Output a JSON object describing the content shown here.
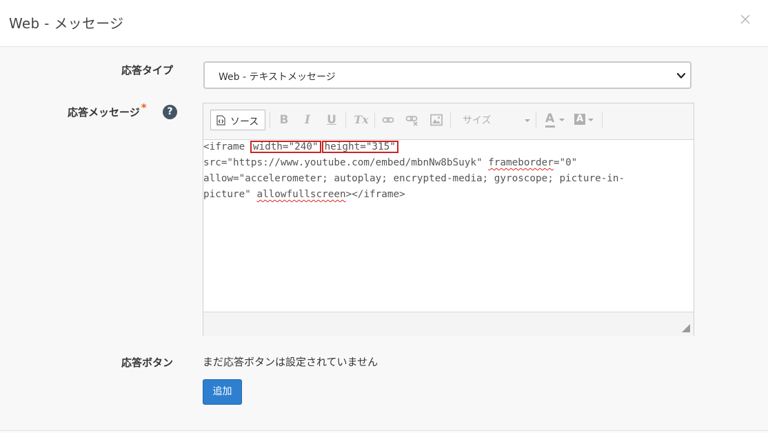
{
  "modal": {
    "title": "Web - メッセージ",
    "close_icon": "close-icon"
  },
  "form": {
    "response_type": {
      "label": "応答タイプ",
      "selected": "Web - テキストメッセージ"
    },
    "response_message": {
      "label": "応答メッセージ",
      "required_mark": "*",
      "help_glyph": "?"
    },
    "response_button": {
      "label": "応答ボタン",
      "empty_text": "まだ応答ボタンは設定されていません",
      "add_label": "追加"
    }
  },
  "toolbar": {
    "source_label": "ソース",
    "bold": "B",
    "italic": "I",
    "underline": "U",
    "remove_format": "Tx",
    "size_label": "サイズ",
    "text_color": "A",
    "bg_color": "A",
    "icons": [
      "source-icon",
      "bold-icon",
      "italic-icon",
      "underline-icon",
      "remove-format-icon",
      "link-icon",
      "unlink-icon",
      "image-icon",
      "text-color-icon",
      "background-color-icon"
    ]
  },
  "editor": {
    "line1_prefix": "<iframe ",
    "line1_width": "width=\"240\"",
    "line1_height": "height=\"315\"",
    "line2_src": "src=\"https://www.youtube.com/embed/mbnNw8bSuyk\" ",
    "line2_fb_attr": "frameborder",
    "line2_fb_val": "=\"0\"",
    "line3": "allow=\"accelerometer; autoplay; encrypted-media; gyroscope; picture-in-",
    "line4_prefix": "picture\" ",
    "line4_attr": "allowfullscreen",
    "line4_suffix": "></iframe>"
  },
  "colors": {
    "accent": "#2e7fcf",
    "highlight_box": "#cc2222",
    "required": "#e8611d",
    "help_icon": "#445566"
  }
}
